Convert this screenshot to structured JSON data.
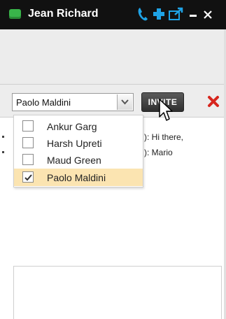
{
  "window": {
    "title": "Jean Richard"
  },
  "toolbar": {
    "selected_contact": "Paolo Maldini",
    "invite_label": "INVITE"
  },
  "contacts_dropdown": {
    "options": [
      {
        "label": "Ankur Garg",
        "checked": false
      },
      {
        "label": "Harsh Upreti",
        "checked": false
      },
      {
        "label": "Maud Green",
        "checked": false
      },
      {
        "label": "Paolo Maldini",
        "checked": true
      }
    ]
  },
  "chat": {
    "messages": [
      {
        "text": "): Hi there,"
      },
      {
        "text": "): Mario"
      }
    ]
  },
  "colors": {
    "titlebar": "#111111",
    "presence": "#39b54a",
    "icon_accent": "#1fa3e6",
    "selected_option": "#fbe4b1",
    "close_red": "#d7261e"
  }
}
